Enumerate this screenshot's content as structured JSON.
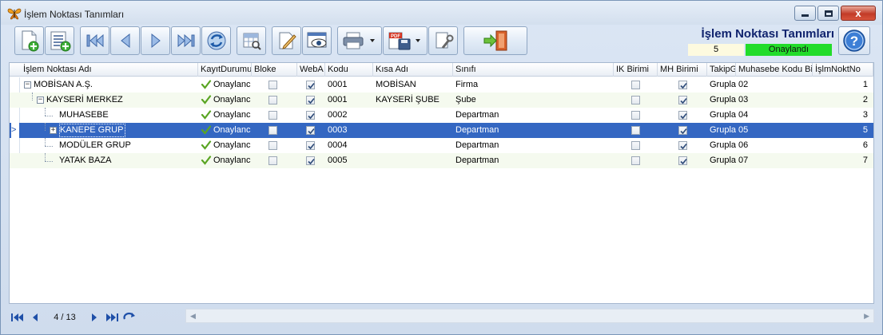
{
  "window": {
    "title": "İşlem Noktası Tanımları",
    "close_label": "x"
  },
  "toolbar": {
    "buttons": [
      {
        "name": "new-record-icon"
      },
      {
        "name": "new-list-icon"
      },
      {
        "name": "first-record-icon"
      },
      {
        "name": "prev-record-icon"
      },
      {
        "name": "next-record-icon"
      },
      {
        "name": "last-record-icon"
      },
      {
        "name": "refresh-icon"
      },
      {
        "name": "grid-view-icon"
      },
      {
        "name": "edit-icon"
      },
      {
        "name": "preview-icon"
      },
      {
        "name": "print-icon"
      },
      {
        "name": "pdf-export-icon"
      },
      {
        "name": "settings-icon"
      },
      {
        "name": "exit-icon"
      }
    ],
    "pdf_label": "PDF"
  },
  "panel": {
    "title": "İşlem Noktası Tanımları",
    "count": "5",
    "status": "Onaylandı",
    "help_label": "?"
  },
  "grid": {
    "columns": [
      {
        "key": "name",
        "label": "İşlem Noktası Adı"
      },
      {
        "key": "status",
        "label": "KayıtDurumu"
      },
      {
        "key": "blocked",
        "label": "Bloke"
      },
      {
        "key": "web",
        "label": "WebA"
      },
      {
        "key": "code",
        "label": "Kodu"
      },
      {
        "key": "short",
        "label": "Kısa Adı"
      },
      {
        "key": "class",
        "label": "Sınıfı"
      },
      {
        "key": "ik",
        "label": "IK Birimi"
      },
      {
        "key": "mh",
        "label": "MH Birimi"
      },
      {
        "key": "track",
        "label": "TakipG"
      },
      {
        "key": "acct",
        "label": "Muhasebe Kodu Bil"
      },
      {
        "key": "no",
        "label": "İşlmNoktNo"
      }
    ],
    "rows": [
      {
        "name": "MOBİSAN A.Ş.",
        "status": "Onaylanc",
        "blocked": false,
        "web": true,
        "code": "0001",
        "short": "MOBİSAN",
        "class": "Firma",
        "ik": false,
        "mh": true,
        "track": "Grupla",
        "acct": "02",
        "no": "1",
        "level": 0,
        "expander": "−"
      },
      {
        "name": "KAYSERİ MERKEZ",
        "status": "Onaylanc",
        "blocked": false,
        "web": true,
        "code": "0001",
        "short": "KAYSERİ ŞUBE",
        "class": "Şube",
        "ik": false,
        "mh": true,
        "track": "Grupla",
        "acct": "03",
        "no": "2",
        "level": 1,
        "expander": "−"
      },
      {
        "name": "MUHASEBE",
        "status": "Onaylanc",
        "blocked": false,
        "web": true,
        "code": "0002",
        "short": "",
        "class": "Departman",
        "ik": false,
        "mh": true,
        "track": "Grupla",
        "acct": "04",
        "no": "3",
        "level": 2,
        "expander": ""
      },
      {
        "name": "KANEPE GRUP",
        "status": "Onaylanc",
        "blocked": false,
        "web": true,
        "code": "0003",
        "short": "",
        "class": "Departman",
        "ik": false,
        "mh": true,
        "track": "Grupla",
        "acct": "05",
        "no": "5",
        "level": 2,
        "expander": "+"
      },
      {
        "name": "MODÜLER GRUP",
        "status": "Onaylanc",
        "blocked": false,
        "web": true,
        "code": "0004",
        "short": "",
        "class": "Departman",
        "ik": false,
        "mh": true,
        "track": "Grupla",
        "acct": "06",
        "no": "6",
        "level": 2,
        "expander": ""
      },
      {
        "name": "YATAK BAZA",
        "status": "Onaylanc",
        "blocked": false,
        "web": true,
        "code": "0005",
        "short": "",
        "class": "Departman",
        "ik": false,
        "mh": true,
        "track": "Grupla",
        "acct": "07",
        "no": "7",
        "level": 2,
        "expander": ""
      }
    ],
    "selected_row": 3,
    "row_indicator": ">"
  },
  "navigator": {
    "position": "4 / 13"
  },
  "colors": {
    "selection": "#3467c2",
    "status_ok": "#22dc2a",
    "title": "#10236e"
  }
}
